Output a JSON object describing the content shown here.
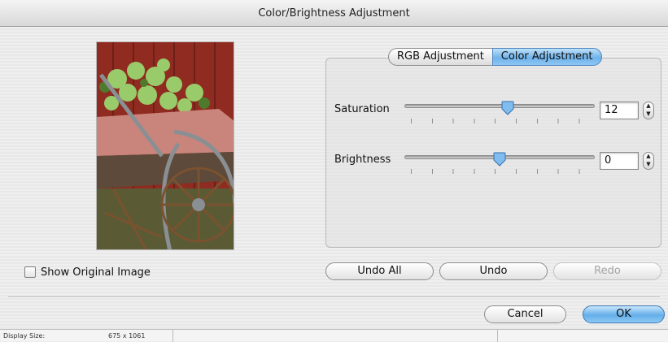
{
  "window": {
    "title": "Color/Brightness Adjustment"
  },
  "preview": {
    "description_icon": "photo-preview"
  },
  "show_original": {
    "label": "Show Original Image",
    "checked": false
  },
  "tabs": [
    {
      "label": "RGB Adjustment",
      "active": false
    },
    {
      "label": "Color Adjustment",
      "active": true
    }
  ],
  "saturation": {
    "label": "Saturation",
    "value": "12"
  },
  "brightness": {
    "label": "Brightness",
    "value": "0"
  },
  "history_buttons": {
    "undo_all": "Undo All",
    "undo": "Undo",
    "redo": "Redo"
  },
  "dialog_buttons": {
    "cancel": "Cancel",
    "ok": "OK"
  },
  "status": {
    "label": "Display Size:",
    "value": "675 x 1061"
  },
  "colors": {
    "accent": "#6fb3ea",
    "accent_border": "#4f86bf"
  }
}
